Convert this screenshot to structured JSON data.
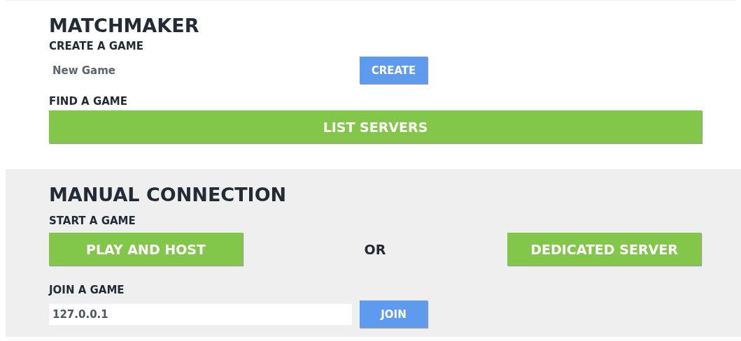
{
  "matchmaker": {
    "title": "MATCHMAKER",
    "create_label": "CREATE A GAME",
    "game_name": {
      "value": "New Game"
    },
    "create_button": "CREATE",
    "find_label": "FIND A GAME",
    "list_button": "LIST SERVERS"
  },
  "manual": {
    "title": "MANUAL CONNECTION",
    "start_label": "START A GAME",
    "host_button": "PLAY AND HOST",
    "or": "OR",
    "dedicated_button": "DEDICATED SERVER",
    "join_label": "JOIN A GAME",
    "address": {
      "value": "127.0.0.1"
    },
    "join_button": "JOIN"
  }
}
